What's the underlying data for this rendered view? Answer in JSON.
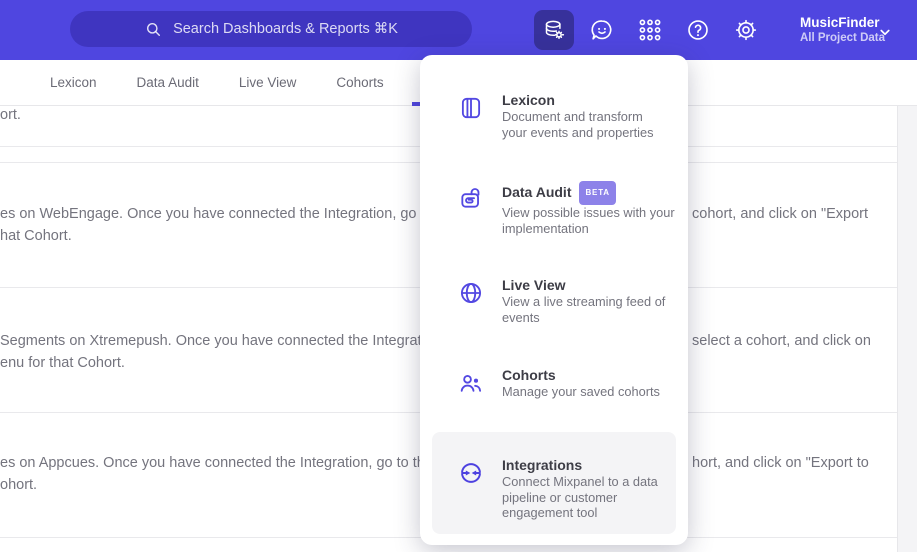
{
  "colors": {
    "brand_purple": "#4f46e0",
    "topbar_tile": "#37319b",
    "beta_badge": "#8d82e9",
    "menu_icon_purple": "#5348e2",
    "highlight_gray": "#f4f4f6"
  },
  "topbar": {
    "search": {
      "placeholder": "Search Dashboards & Reports ⌘K",
      "icon": "search-icon"
    },
    "icons": [
      "data-management-icon",
      "feedback-chat-icon",
      "apps-grid-icon",
      "help-icon",
      "settings-gear-icon"
    ],
    "project": {
      "name": "MusicFinder",
      "subtitle": "All Project Data",
      "chevron": "chevron-down-icon"
    }
  },
  "tabbar": {
    "tabs": [
      {
        "label": "Lexicon"
      },
      {
        "label": "Data Audit"
      },
      {
        "label": "Live View"
      },
      {
        "label": "Cohorts"
      }
    ]
  },
  "menu": {
    "items": [
      {
        "title": "Lexicon",
        "icon": "book-icon",
        "desc_lines": [
          "Document and transform",
          "your events and properties"
        ]
      },
      {
        "title": "Data Audit",
        "badge": "BETA",
        "icon": "lock-audit-icon",
        "desc_lines": [
          "View possible issues with your",
          "implementation"
        ]
      },
      {
        "title": "Live View",
        "icon": "globe-icon",
        "desc_lines": [
          "View a live streaming feed of",
          "events"
        ]
      },
      {
        "title": "Cohorts",
        "icon": "people-icon",
        "desc_lines": [
          "Manage your saved cohorts"
        ]
      },
      {
        "title": "Integrations",
        "icon": "sync-arrows-icon",
        "highlighted": true,
        "desc_lines": [
          "Connect Mixpanel to a data",
          "pipeline or customer",
          "engagement tool"
        ]
      }
    ]
  },
  "content": {
    "rows": [
      {
        "line1_left": "ort.",
        "line1_right": "",
        "line2_left": ""
      },
      {
        "line1_left": "es on WebEngage. Once you have connected the Integration, go to the",
        "line1_right": "cohort, and click on \"Export",
        "line2_left": "hat Cohort."
      },
      {
        "line1_left": "Segments on Xtremepush. Once you have connected the Integration,",
        "line1_right": "select a cohort, and click on",
        "line2_left": "enu for that Cohort."
      },
      {
        "line1_left": "es on Appcues. Once you have connected the Integration, go to the M",
        "line1_right": "hort, and click on \"Export to",
        "line2_left": "ohort."
      }
    ]
  }
}
